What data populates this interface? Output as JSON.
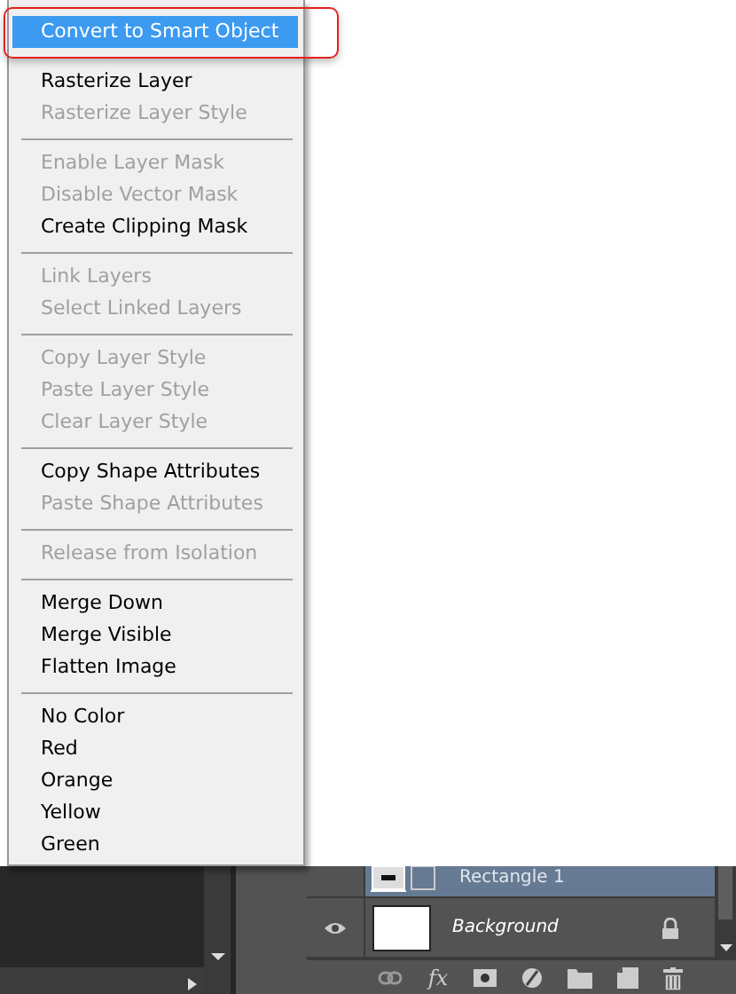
{
  "context_menu": {
    "groups": [
      {
        "items": [
          {
            "label": "Convert to Smart Object",
            "disabled": false,
            "selected": true
          }
        ]
      },
      {
        "items": [
          {
            "label": "Rasterize Layer",
            "disabled": false,
            "selected": false
          },
          {
            "label": "Rasterize Layer Style",
            "disabled": true,
            "selected": false
          }
        ]
      },
      {
        "items": [
          {
            "label": "Enable Layer Mask",
            "disabled": true,
            "selected": false
          },
          {
            "label": "Disable Vector Mask",
            "disabled": true,
            "selected": false
          },
          {
            "label": "Create Clipping Mask",
            "disabled": false,
            "selected": false
          }
        ]
      },
      {
        "items": [
          {
            "label": "Link Layers",
            "disabled": true,
            "selected": false
          },
          {
            "label": "Select Linked Layers",
            "disabled": true,
            "selected": false
          }
        ]
      },
      {
        "items": [
          {
            "label": "Copy Layer Style",
            "disabled": true,
            "selected": false
          },
          {
            "label": "Paste Layer Style",
            "disabled": true,
            "selected": false
          },
          {
            "label": "Clear Layer Style",
            "disabled": true,
            "selected": false
          }
        ]
      },
      {
        "items": [
          {
            "label": "Copy Shape Attributes",
            "disabled": false,
            "selected": false
          },
          {
            "label": "Paste Shape Attributes",
            "disabled": true,
            "selected": false
          }
        ]
      },
      {
        "items": [
          {
            "label": "Release from Isolation",
            "disabled": true,
            "selected": false
          }
        ]
      },
      {
        "items": [
          {
            "label": "Merge Down",
            "disabled": false,
            "selected": false
          },
          {
            "label": "Merge Visible",
            "disabled": false,
            "selected": false
          },
          {
            "label": "Flatten Image",
            "disabled": false,
            "selected": false
          }
        ]
      },
      {
        "items": [
          {
            "label": "No Color",
            "disabled": false,
            "selected": false
          },
          {
            "label": "Red",
            "disabled": false,
            "selected": false
          },
          {
            "label": "Orange",
            "disabled": false,
            "selected": false
          },
          {
            "label": "Yellow",
            "disabled": false,
            "selected": false
          },
          {
            "label": "Green",
            "disabled": false,
            "selected": false
          }
        ]
      }
    ]
  },
  "layers": [
    {
      "name": "Rectangle 1",
      "kind": "shape",
      "selected": true,
      "locked": false
    },
    {
      "name": "Background",
      "kind": "background",
      "selected": false,
      "locked": true
    }
  ],
  "layers_toolbar": {
    "effects_label": "fx"
  }
}
